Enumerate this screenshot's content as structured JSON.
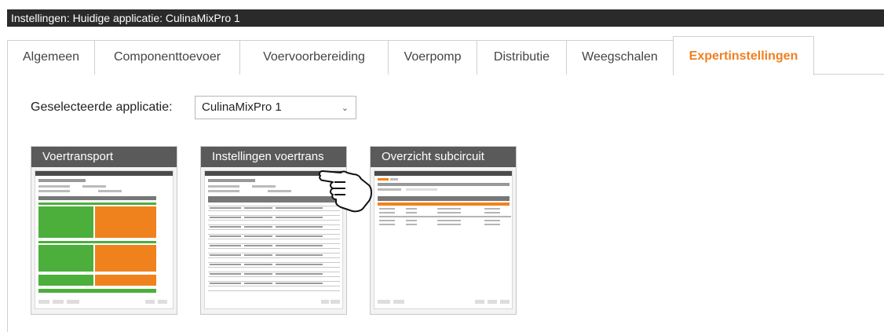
{
  "window": {
    "title": "Instellingen: Huidige applicatie: CulinaMixPro 1"
  },
  "tabs": [
    {
      "label": "Algemeen",
      "active": false
    },
    {
      "label": "Componenttoevoer",
      "active": false
    },
    {
      "label": "Voervoorbereiding",
      "active": false
    },
    {
      "label": "Voerpomp",
      "active": false
    },
    {
      "label": "Distributie",
      "active": false
    },
    {
      "label": "Weegschalen",
      "active": false
    },
    {
      "label": "Expertinstellingen",
      "active": true
    }
  ],
  "selection": {
    "label": "Geselecteerde applicatie:",
    "value": "CulinaMixPro 1"
  },
  "cards": [
    {
      "title": "Voertransport"
    },
    {
      "title": "Instellingen voertrans"
    },
    {
      "title": "Overzicht subcircuit"
    }
  ],
  "colors": {
    "accent": "#f08020",
    "titlebar": "#2a2a2a",
    "card_header": "#5a5a5a",
    "thumb_green": "#4caf3c",
    "thumb_orange": "#f0821e"
  },
  "icons": {
    "cursor": "pointing-hand-icon",
    "dropdown": "chevron-down-icon"
  }
}
